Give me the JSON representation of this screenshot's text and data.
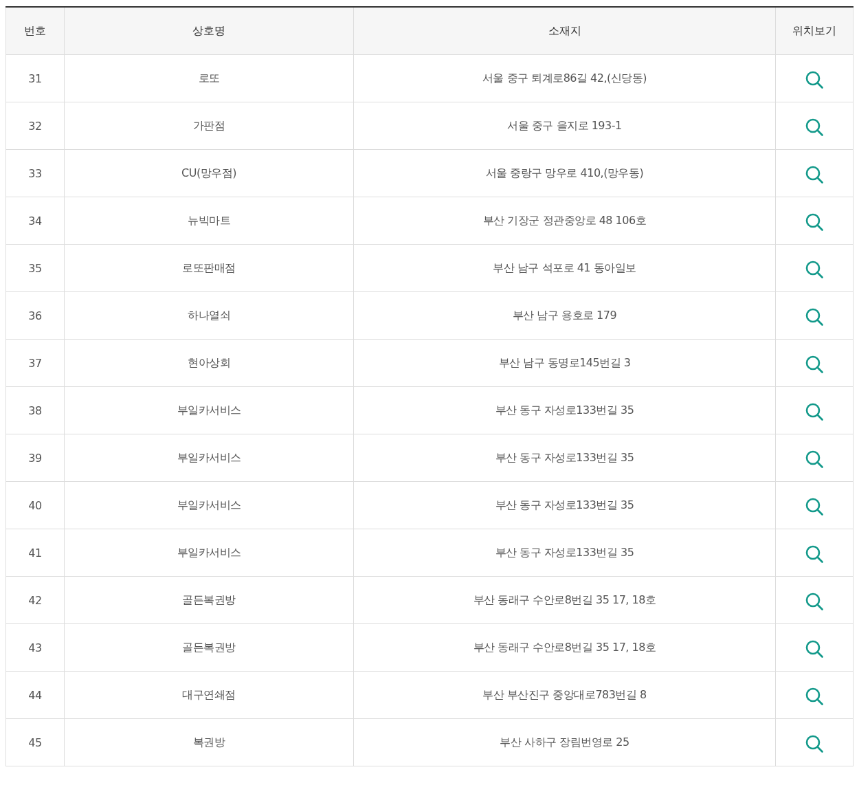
{
  "table": {
    "columns": [
      "번호",
      "상호명",
      "소재지",
      "위치보기"
    ],
    "rows": [
      {
        "no": "31",
        "name": "로또",
        "address": "서울 중구 퇴계로86길 42,(신당동)"
      },
      {
        "no": "32",
        "name": "가판점",
        "address": "서울 중구 을지로 193-1"
      },
      {
        "no": "33",
        "name": "CU(망우점)",
        "address": "서울 중랑구 망우로 410,(망우동)"
      },
      {
        "no": "34",
        "name": "뉴빅마트",
        "address": "부산 기장군 정관중앙로 48 106호"
      },
      {
        "no": "35",
        "name": "로또판매점",
        "address": "부산 남구 석포로 41 동아일보"
      },
      {
        "no": "36",
        "name": "하나열쇠",
        "address": "부산 남구 용호로 179"
      },
      {
        "no": "37",
        "name": "현아상회",
        "address": "부산 남구 동명로145번길 3"
      },
      {
        "no": "38",
        "name": "부일카서비스",
        "address": "부산 동구 자성로133번길 35"
      },
      {
        "no": "39",
        "name": "부일카서비스",
        "address": "부산 동구 자성로133번길 35"
      },
      {
        "no": "40",
        "name": "부일카서비스",
        "address": "부산 동구 자성로133번길 35"
      },
      {
        "no": "41",
        "name": "부일카서비스",
        "address": "부산 동구 자성로133번길 35"
      },
      {
        "no": "42",
        "name": "골든복권방",
        "address": "부산 동래구 수안로8번길 35 17, 18호"
      },
      {
        "no": "43",
        "name": "골든복권방",
        "address": "부산 동래구 수안로8번길 35 17, 18호"
      },
      {
        "no": "44",
        "name": "대구연쇄점",
        "address": "부산 부산진구 중앙대로783번길 8"
      },
      {
        "no": "45",
        "name": "복권방",
        "address": "부산 사하구 장림번영로 25"
      }
    ]
  }
}
